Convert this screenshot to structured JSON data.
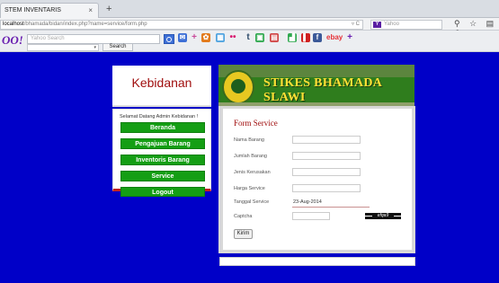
{
  "browser": {
    "tab_title": "STEM INVENTARIS",
    "tab_close": "×",
    "new_tab": "+",
    "url_host": "localhost",
    "url_path": "/bhamada/bidan/index.php?name=service/form.php",
    "url_controls": "▿ C",
    "search_placeholder": "Yahoo",
    "yahoo_icon_letter": "Y",
    "nav_icons": "⚲ ☆ ▤ ⬇"
  },
  "toolbar": {
    "logo": "OO!",
    "search_placeholder": "Yahoo Search",
    "search_button": "Search",
    "select_arrow": "▾",
    "icons": [
      {
        "name": "mail-icon",
        "glyph": "✉",
        "color": "#3d6fd6"
      },
      {
        "name": "plus-icon",
        "glyph": "+",
        "color": "#c94a9a"
      },
      {
        "name": "pinwheel-icon",
        "glyph": "✿",
        "color": "#e27a1b"
      },
      {
        "name": "image-icon",
        "glyph": "▦",
        "color": "#4fa3df"
      },
      {
        "name": "flickr-icon",
        "glyph": "••",
        "color": "#d8186e"
      },
      {
        "name": "tumblr-icon",
        "glyph": "t",
        "color": "#2d4a6a"
      },
      {
        "name": "news-icon",
        "glyph": "▣",
        "color": "#2fa84f"
      },
      {
        "name": "calendar-icon",
        "glyph": "▤",
        "color": "#d04545"
      },
      {
        "name": "chart-icon",
        "glyph": "▟",
        "color": "#2fa84f"
      },
      {
        "name": "bookmark-icon",
        "glyph": "▌",
        "color": "#d02020"
      },
      {
        "name": "facebook-icon",
        "glyph": "f",
        "color": "#3b5998"
      },
      {
        "name": "ebay-icon",
        "glyph": "ebay",
        "color": "#e53238"
      },
      {
        "name": "add-icon",
        "glyph": "+",
        "color": "#6a1fb0"
      }
    ]
  },
  "sidebar": {
    "title": "Kebidanan",
    "greeting": "Selamat Datang Admin Kebidanan !",
    "menu": [
      {
        "label": "Beranda"
      },
      {
        "label": "Pengajuan Barang"
      },
      {
        "label": "Inventoris Barang"
      },
      {
        "label": "Service"
      },
      {
        "label": "Logout"
      }
    ]
  },
  "banner": {
    "text": "STIKES BHAMADA SLAWI",
    "logo_text": "BHAMADA"
  },
  "form": {
    "title": "Form Service",
    "fields": [
      {
        "label": "Nama Barang",
        "value": ""
      },
      {
        "label": "Jumlah Barang",
        "value": ""
      },
      {
        "label": "Jenis Kerusakan",
        "value": ""
      },
      {
        "label": "Harga Service",
        "value": ""
      },
      {
        "label": "Tanggal Service",
        "value": "23-Aug-2014"
      },
      {
        "label": "Captcha",
        "value": ""
      }
    ],
    "captcha_text": "efqa9",
    "submit_label": "Kirim"
  },
  "colors": {
    "page_background": "#0000c8",
    "menu_button": "#149e14",
    "title_red": "#a00e0e",
    "banner_green": "#2f7d1d",
    "banner_text": "#ffe135"
  }
}
